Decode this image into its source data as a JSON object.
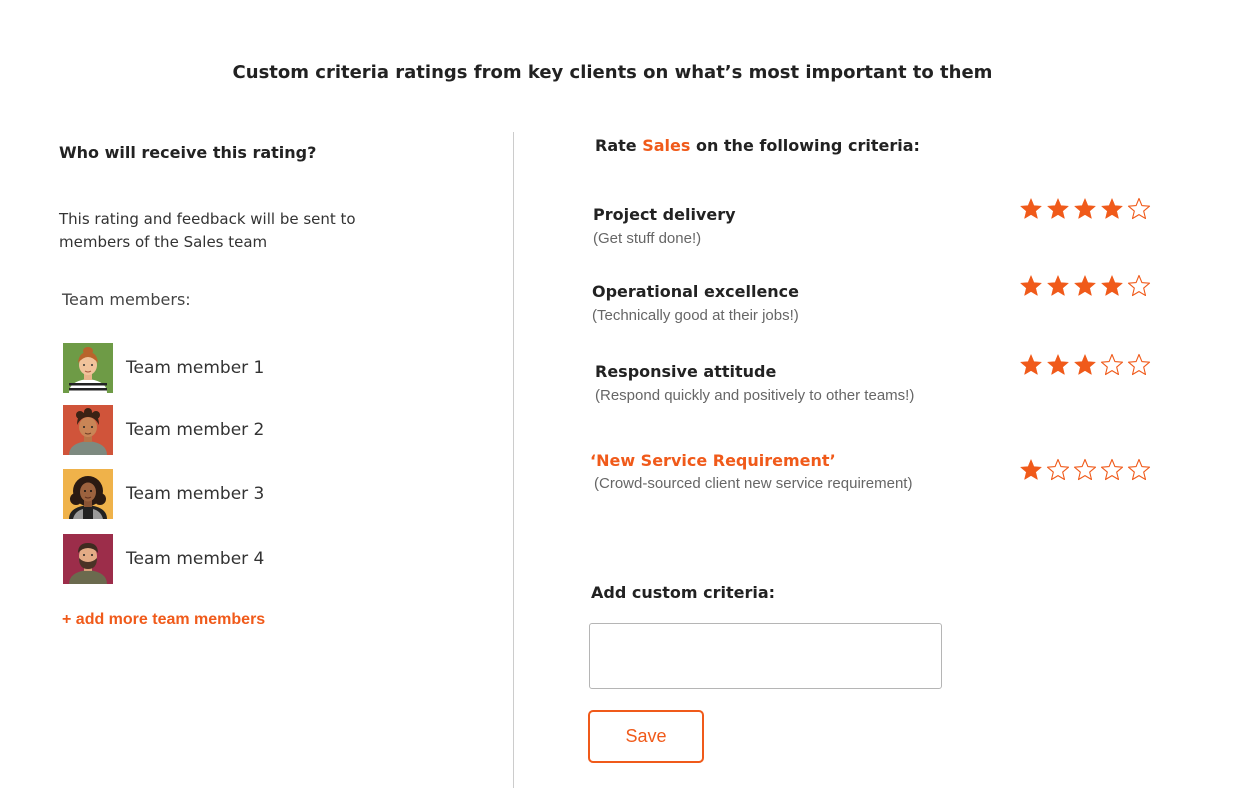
{
  "page": {
    "title": "Custom criteria ratings from key clients on what’s most important to them"
  },
  "recipient": {
    "heading": "Who will receive this rating?",
    "description": "This rating and feedback will be sent to members of the Sales team",
    "members_label": "Team members:",
    "members": [
      {
        "name": "Team member 1"
      },
      {
        "name": "Team member 2"
      },
      {
        "name": "Team member 3"
      },
      {
        "name": "Team member 4"
      }
    ],
    "add_more": "+ add more team members"
  },
  "rating": {
    "heading_prefix": "Rate ",
    "team": "Sales",
    "heading_suffix": " on the following criteria:",
    "max_stars": 5,
    "criteria": [
      {
        "title": "Project delivery",
        "subtitle": "(Get stuff done!)",
        "rating": 4
      },
      {
        "title": "Operational excellence",
        "subtitle": "(Technically good at their jobs!)",
        "rating": 4
      },
      {
        "title": "Responsive attitude",
        "subtitle": "(Respond quickly and positively to other teams!)",
        "rating": 3
      },
      {
        "title": "‘New Service Requirement’",
        "subtitle": "(Crowd-sourced client new service requirement)",
        "rating": 1
      }
    ]
  },
  "custom": {
    "label": "Add custom criteria:",
    "input_value": "",
    "placeholder": "",
    "save_label": "Save"
  },
  "colors": {
    "accent": "#f05a1a",
    "divider": "#cccccc"
  },
  "icons": {
    "star_filled": "star-filled-icon",
    "star_empty": "star-outline-icon"
  }
}
